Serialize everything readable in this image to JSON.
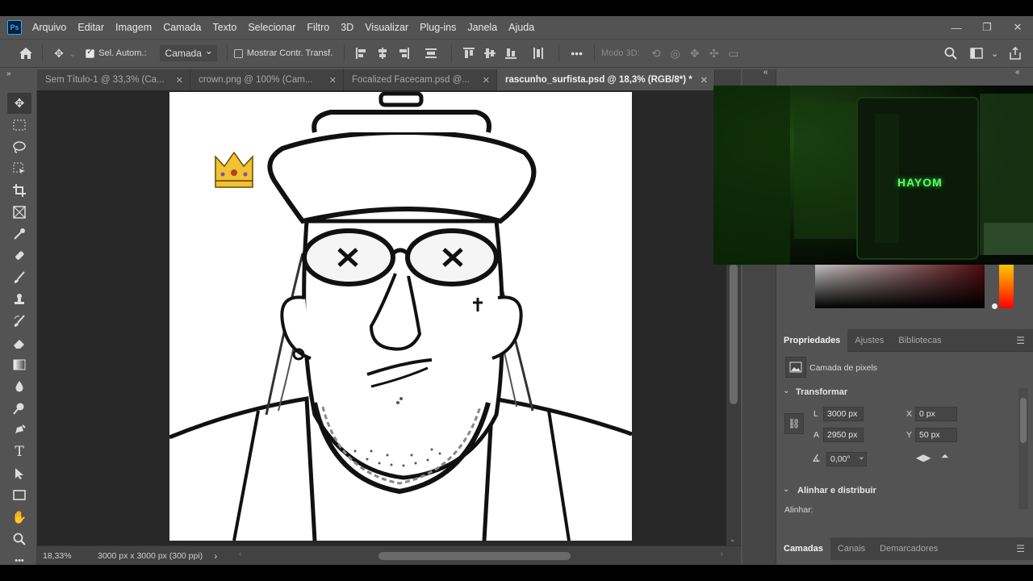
{
  "menubar": {
    "logo": "Ps",
    "items": [
      "Arquivo",
      "Editar",
      "Imagem",
      "Camada",
      "Texto",
      "Selecionar",
      "Filtro",
      "3D",
      "Visualizar",
      "Plug-ins",
      "Janela",
      "Ajuda"
    ]
  },
  "options": {
    "auto_select_label": "Sel. Autom.:",
    "auto_select_value": "Camada",
    "show_transform_label": "Mostrar Contr. Transf.",
    "more": "•••",
    "mode3d_label": "Modo 3D:"
  },
  "tabs": [
    {
      "label": "Sem Título-1 @ 33,3% (Ca...",
      "active": false
    },
    {
      "label": "crown.png @ 100% (Cam...",
      "active": false
    },
    {
      "label": "Focalized Facecam.psd @...",
      "active": false
    },
    {
      "label": "rascunho_surfista.psd @ 18,3% (RGB/8*) *",
      "active": true
    }
  ],
  "status": {
    "zoom": "18,33%",
    "doc_info": "3000 px x 3000 px (300 ppi)"
  },
  "webcam": {
    "brand": "HAYOM"
  },
  "properties": {
    "tabs": [
      "Propriedades",
      "Ajustes",
      "Bibliotecas"
    ],
    "layer_type": "Camada de pixels",
    "transform_title": "Transformar",
    "w_label": "L",
    "w_value": "3000 px",
    "h_label": "A",
    "h_value": "2950 px",
    "x_label": "X",
    "x_value": "0 px",
    "y_label": "Y",
    "y_value": "50 px",
    "angle_value": "0,00°",
    "align_title": "Alinhar e distribuir",
    "align_label": "Alinhar:"
  },
  "layers_panel": {
    "tabs": [
      "Camadas",
      "Canais",
      "Demarcadores"
    ]
  },
  "colors": {
    "ui_bg": "#535353",
    "canvas_bg": "#282828",
    "accent": "#31a8ff"
  }
}
